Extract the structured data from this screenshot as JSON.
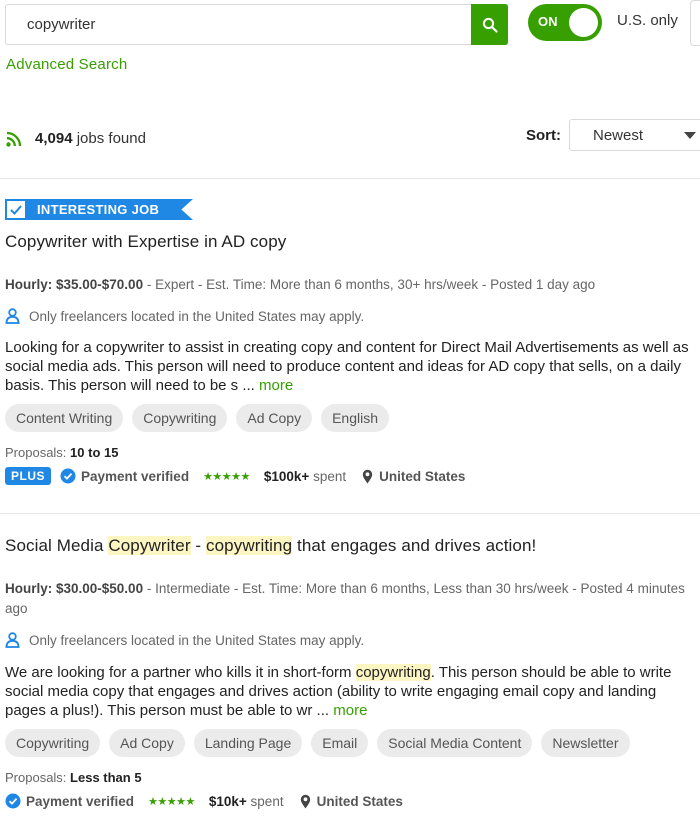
{
  "search": {
    "value": "copywriter"
  },
  "toggle": {
    "label": "ON",
    "state": "on"
  },
  "us_only_label": "U.S. only",
  "advanced_search": "Advanced Search",
  "results": {
    "count": "4,094",
    "suffix": " jobs found"
  },
  "sort": {
    "label": "Sort:",
    "value": "Newest"
  },
  "colors": {
    "accent_green": "#37a000",
    "accent_blue": "#1f88e5",
    "highlight": "#fdf6c3"
  },
  "icons": [
    "search-icon",
    "rss-icon",
    "chevron-down-icon",
    "checkmark-icon",
    "person-icon",
    "verified-icon",
    "location-pin-icon"
  ],
  "jobs": [
    {
      "badge": "INTERESTING JOB",
      "title": "Copywriter with Expertise in AD copy",
      "rate": "Hourly: $35.00-$70.00",
      "meta": " - Expert - Est. Time: More than 6 months, 30+ hrs/week - Posted 1 day ago",
      "location_note": "Only freelancers located in the United States may apply.",
      "description": "Looking for a copywriter to assist in creating copy and content for Direct Mail Advertisements as well as social media ads. This person will need to produce content and ideas for AD copy that sells, on a daily basis. This person will need to be s ...",
      "more": "more",
      "tags": [
        "Content Writing",
        "Copywriting",
        "Ad Copy",
        "English"
      ],
      "proposals_label": "Proposals:",
      "proposals_value": "10 to 15",
      "plus": "PLUS",
      "payment": "Payment verified",
      "rating_stars": 5,
      "spent_amount": "$100k+",
      "spent_label": "spent",
      "country": "United States"
    },
    {
      "title_parts": [
        "Social Media ",
        "Copywriter",
        " - ",
        "copywriting",
        " that engages and drives action!"
      ],
      "rate": "Hourly: $30.00-$50.00",
      "meta": " - Intermediate - Est. Time: More than 6 months, Less than 30 hrs/week - Posted 4 minutes ago",
      "location_note": "Only freelancers located in the United States may apply.",
      "description_parts": [
        "We are looking for a partner who kills it in short-form ",
        "copywriting",
        ". This person should be able to write social media copy that engages and drives action (ability to write engaging email copy and landing pages a plus!). This person must be able to wr ..."
      ],
      "more": "more",
      "tags": [
        "Copywriting",
        "Ad Copy",
        "Landing Page",
        "Email",
        "Social Media Content",
        "Newsletter"
      ],
      "proposals_label": "Proposals:",
      "proposals_value": "Less than 5",
      "payment": "Payment verified",
      "rating_stars": 5,
      "spent_amount": "$10k+",
      "spent_label": "spent",
      "country": "United States"
    }
  ]
}
